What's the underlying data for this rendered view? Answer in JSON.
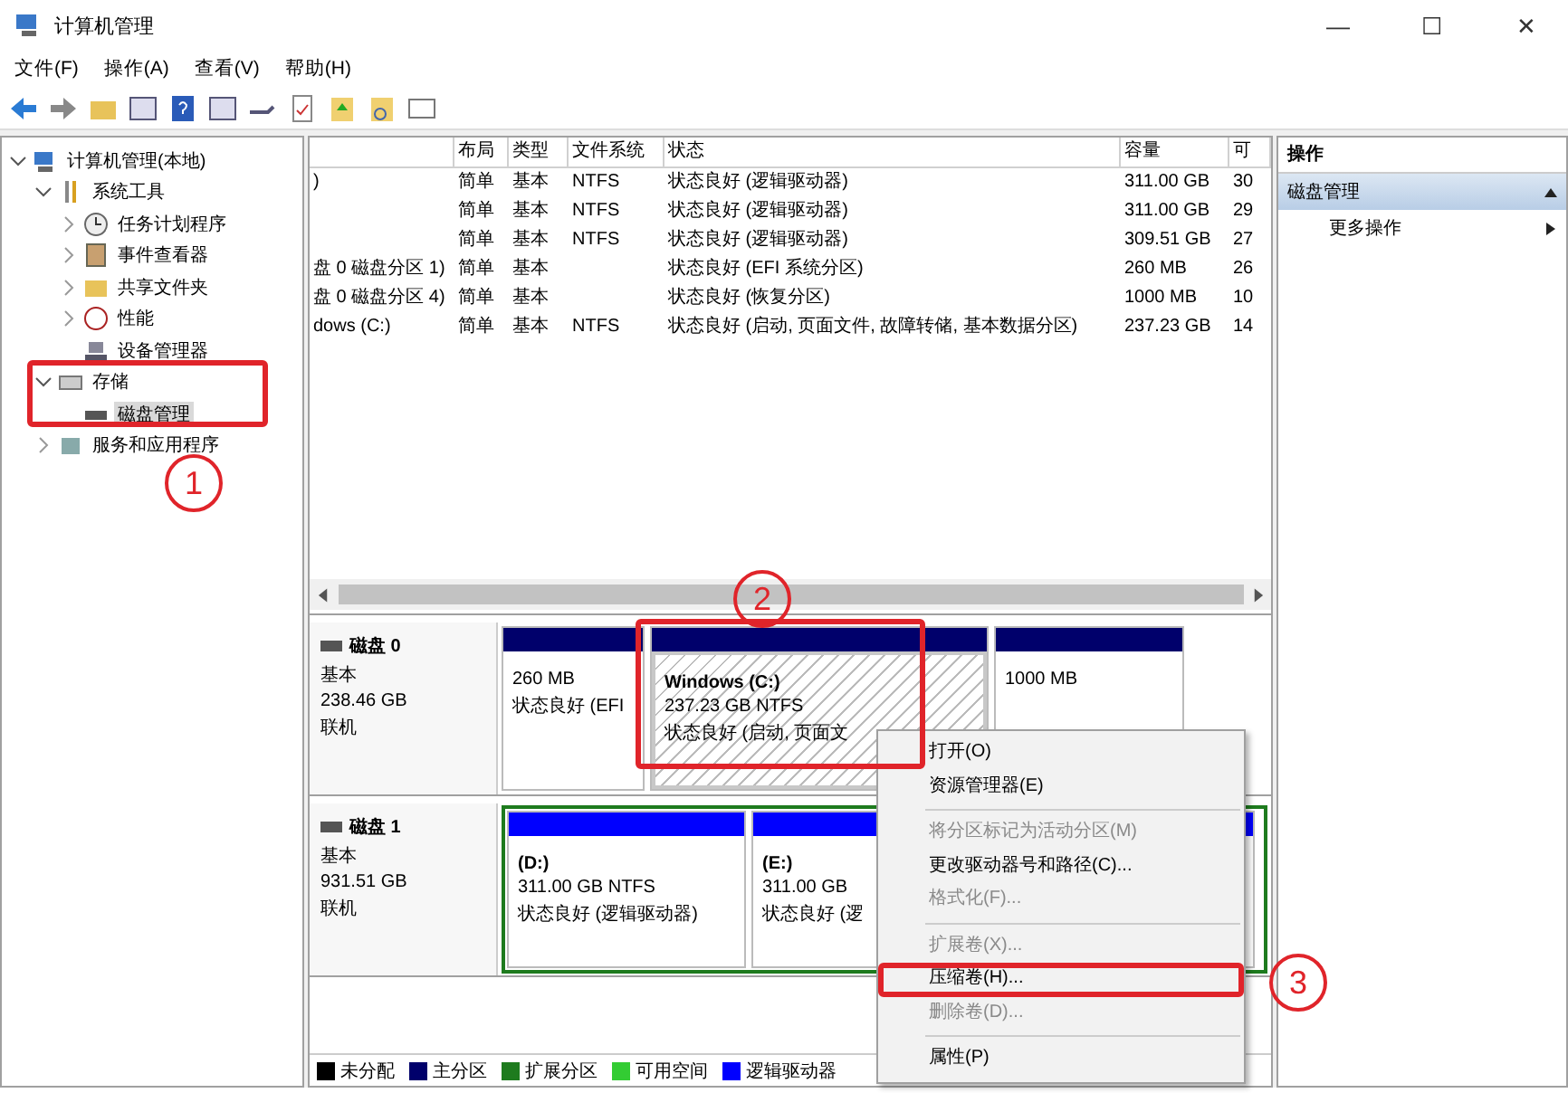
{
  "window": {
    "title": "计算机管理",
    "controls": [
      "—",
      "☐",
      "✕"
    ]
  },
  "menu": [
    "文件(F)",
    "操作(A)",
    "查看(V)",
    "帮助(H)"
  ],
  "tree": [
    {
      "label": "计算机管理(本地)",
      "expanded": true,
      "children": [
        {
          "label": "系统工具",
          "expanded": true,
          "children": [
            {
              "label": "任务计划程序",
              "expanded": false
            },
            {
              "label": "事件查看器",
              "expanded": false
            },
            {
              "label": "共享文件夹",
              "expanded": false
            },
            {
              "label": "性能",
              "expanded": false
            },
            {
              "label": "设备管理器"
            }
          ]
        },
        {
          "label": "存储",
          "expanded": true,
          "children": [
            {
              "label": "磁盘管理",
              "selected": true
            }
          ]
        },
        {
          "label": "服务和应用程序",
          "expanded": false
        }
      ]
    }
  ],
  "table": {
    "columns": [
      "",
      "布局",
      "类型",
      "文件系统",
      "状态",
      "容量",
      "可"
    ],
    "rows": [
      [
        ")",
        "简单",
        "基本",
        "NTFS",
        "状态良好 (逻辑驱动器)",
        "311.00 GB",
        "30"
      ],
      [
        "",
        "简单",
        "基本",
        "NTFS",
        "状态良好 (逻辑驱动器)",
        "311.00 GB",
        "29"
      ],
      [
        "",
        "简单",
        "基本",
        "NTFS",
        "状态良好 (逻辑驱动器)",
        "309.51 GB",
        "27"
      ],
      [
        "盘 0 磁盘分区 1)",
        "简单",
        "基本",
        "",
        "状态良好 (EFI 系统分区)",
        "260 MB",
        "26"
      ],
      [
        "盘 0 磁盘分区 4)",
        "简单",
        "基本",
        "",
        "状态良好 (恢复分区)",
        "1000 MB",
        "10"
      ],
      [
        "dows (C:)",
        "简单",
        "基本",
        "NTFS",
        "状态良好 (启动, 页面文件, 故障转储, 基本数据分区)",
        "237.23 GB",
        "14"
      ]
    ]
  },
  "disks": [
    {
      "name": "磁盘 0",
      "type": "基本",
      "size": "238.46 GB",
      "state": "联机",
      "extended": false,
      "partitions": [
        {
          "kind": "primary",
          "hatched": false,
          "size": "260 MB",
          "status": "状态良好 (EFI"
        },
        {
          "kind": "primary",
          "hatched": true,
          "title": "Windows  (C:)",
          "size": "237.23 GB NTFS",
          "status": "状态良好 (启动, 页面文"
        },
        {
          "kind": "primary",
          "hatched": false,
          "size": "1000 MB"
        }
      ]
    },
    {
      "name": "磁盘 1",
      "type": "基本",
      "size": "931.51 GB",
      "state": "联机",
      "extended": true,
      "partitions": [
        {
          "kind": "logical",
          "hatched": false,
          "title": "(D:)",
          "size": "311.00 GB NTFS",
          "status": "状态良好 (逻辑驱动器)"
        },
        {
          "kind": "logical",
          "hatched": false,
          "title": "(E:)",
          "size": "311.00 GB",
          "status": "状态良好 (逻"
        },
        {
          "kind": "logical",
          "hatched": false
        }
      ]
    }
  ],
  "legend": [
    {
      "label": "未分配",
      "color": "#000000"
    },
    {
      "label": "主分区",
      "color": "#00006b"
    },
    {
      "label": "扩展分区",
      "color": "#1e7b1e"
    },
    {
      "label": "可用空间",
      "color": "#33cc33"
    },
    {
      "label": "逻辑驱动器",
      "color": "#0000ff"
    }
  ],
  "actions": {
    "title": "操作",
    "section": "磁盘管理",
    "items": [
      "更多操作"
    ]
  },
  "context_menu": [
    {
      "kind": "item",
      "label": "打开(O)",
      "disabled": false
    },
    {
      "kind": "item",
      "label": "资源管理器(E)",
      "disabled": false
    },
    {
      "kind": "separator"
    },
    {
      "kind": "item",
      "label": "将分区标记为活动分区(M)",
      "disabled": true
    },
    {
      "kind": "item",
      "label": "更改驱动器号和路径(C)...",
      "disabled": false
    },
    {
      "kind": "item",
      "label": "格式化(F)...",
      "disabled": true
    },
    {
      "kind": "separator"
    },
    {
      "kind": "item",
      "label": "扩展卷(X)...",
      "disabled": true
    },
    {
      "kind": "item",
      "label": "压缩卷(H)...",
      "disabled": false
    },
    {
      "kind": "item",
      "label": "删除卷(D)...",
      "disabled": true
    },
    {
      "kind": "separator"
    },
    {
      "kind": "item",
      "label": "属性(P)",
      "disabled": false
    }
  ],
  "annotations": [
    "1",
    "2",
    "3"
  ]
}
